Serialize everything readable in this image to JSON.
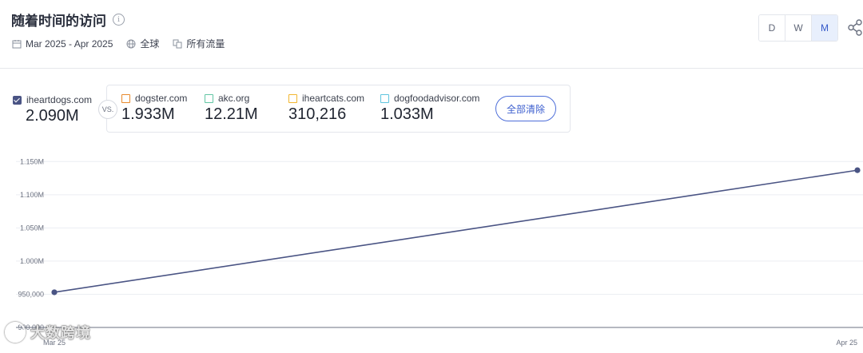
{
  "header": {
    "title": "随着时间的访问",
    "date_range": "Mar 2025 - Apr 2025",
    "region": "全球",
    "traffic": "所有流量"
  },
  "period": {
    "buttons": [
      "D",
      "W",
      "M"
    ],
    "active": "M"
  },
  "primary_site": {
    "name": "iheartdogs.com",
    "value": "2.090M",
    "color": "#4a5484"
  },
  "vs_label": "VS.",
  "competitors": [
    {
      "name": "dogster.com",
      "value": "1.933M",
      "color": "#e8892b"
    },
    {
      "name": "akc.org",
      "value": "12.21M",
      "color": "#62c6a4"
    },
    {
      "name": "iheartcats.com",
      "value": "310,216",
      "color": "#f2b62f"
    },
    {
      "name": "dogfoodadvisor.com",
      "value": "1.033M",
      "color": "#5fc5df"
    }
  ],
  "clear_all_label": "全部清除",
  "chart_data": {
    "type": "line",
    "x": [
      "Mar 25",
      "Apr 25"
    ],
    "series": [
      {
        "name": "iheartdogs.com",
        "values": [
          953000,
          1137000
        ],
        "color": "#4a5484"
      }
    ],
    "ylim": [
      900000,
      1160000
    ],
    "yticks": [
      900000,
      950000,
      1000000,
      1050000,
      1100000,
      1150000
    ],
    "ytick_labels": [
      "900,000",
      "950,000",
      "1.000M",
      "1.050M",
      "1.100M",
      "1.150M"
    ],
    "grid": true
  },
  "watermark": "大数跨境"
}
